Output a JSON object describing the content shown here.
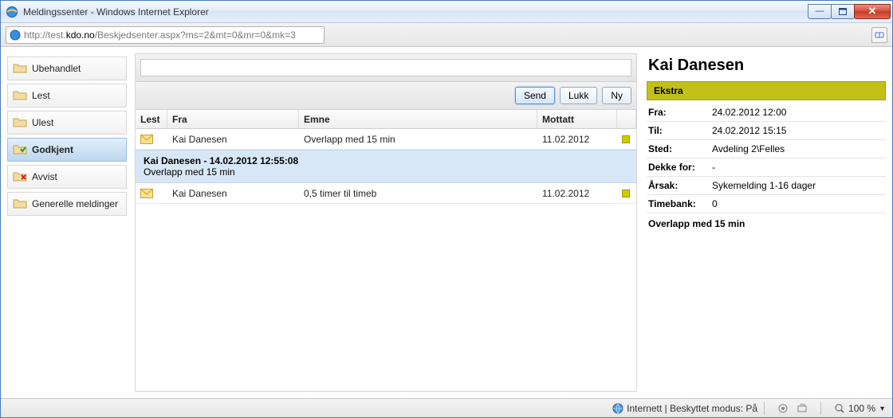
{
  "window": {
    "title": "Meldingssenter - Windows Internet Explorer"
  },
  "url": {
    "prefix": "http://test.",
    "host": "kdo.no",
    "path": "/Beskjedsenter.aspx?ms=2&mt=0&mr=0&mk=3"
  },
  "sidebar": {
    "items": [
      {
        "label": "Ubehandlet"
      },
      {
        "label": "Lest"
      },
      {
        "label": "Ulest"
      },
      {
        "label": "Godkjent"
      },
      {
        "label": "Avvist"
      },
      {
        "label": "Generelle meldinger"
      }
    ],
    "active_index": 3
  },
  "toolbar": {
    "search_value": ""
  },
  "buttons": {
    "send": "Send",
    "close": "Lukk",
    "new": "Ny"
  },
  "grid": {
    "headers": {
      "lest": "Lest",
      "fra": "Fra",
      "emne": "Emne",
      "mottatt": "Mottatt"
    },
    "rows": [
      {
        "fra": "Kai Danesen",
        "emne": "Overlapp med 15 min",
        "mottatt": "11.02.2012"
      },
      {
        "fra": "Kai Danesen",
        "emne": "0,5 timer til timeb",
        "mottatt": "11.02.2012"
      }
    ],
    "detail": {
      "header": "Kai Danesen - 14.02.2012 12:55:08",
      "body": "Overlapp med 15 min"
    }
  },
  "right": {
    "title": "Kai Danesen",
    "banner": "Ekstra",
    "fields": {
      "fra_label": "Fra:",
      "fra_val": "24.02.2012 12:00",
      "til_label": "Til:",
      "til_val": "24.02.2012 15:15",
      "sted_label": "Sted:",
      "sted_val": "Avdeling 2\\Felles",
      "dekke_label": "Dekke for:",
      "dekke_val": "-",
      "arsak_label": "Årsak:",
      "arsak_val": "Sykemelding 1-16 dager",
      "timebank_label": "Timebank:",
      "timebank_val": "0"
    },
    "extra": "Overlapp med 15 min"
  },
  "status": {
    "zone": "Internett | Beskyttet modus: På",
    "zoom": "100 %"
  }
}
